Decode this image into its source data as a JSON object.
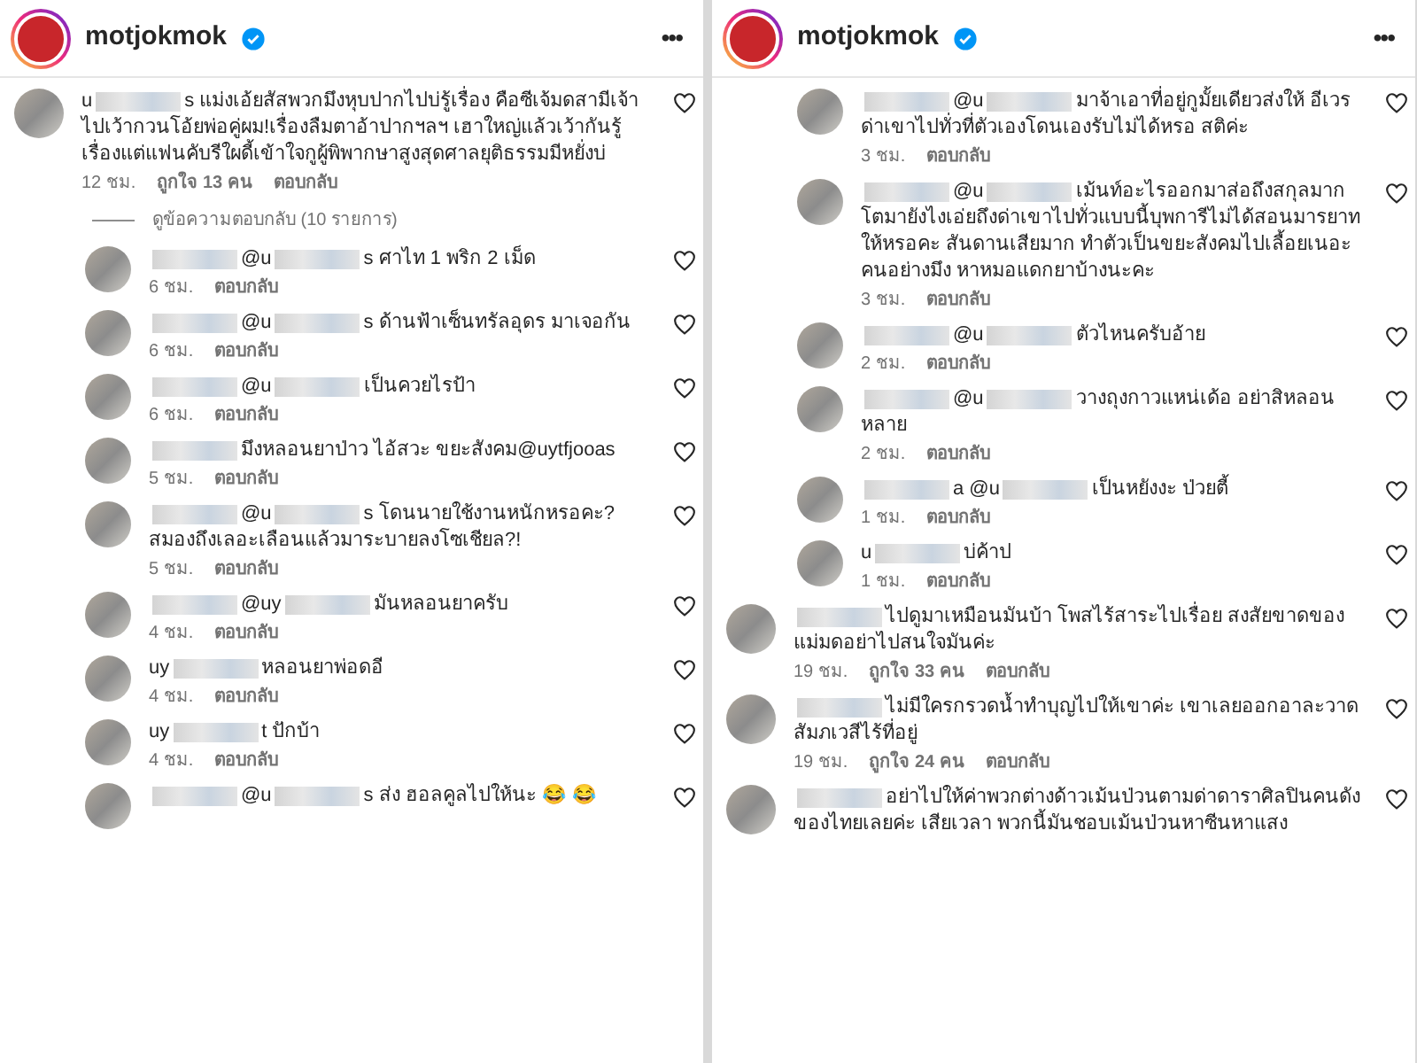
{
  "panels": [
    {
      "header": {
        "username": "motjokmok",
        "verified": true,
        "more": "•••"
      },
      "items": [
        {
          "kind": "comment",
          "segments": [
            {
              "kind": "text",
              "text": "u"
            },
            {
              "kind": "blur"
            },
            {
              "kind": "text",
              "text": "s แม่งเอ้ยสัสพวกมึงหุบปากไปบ่รู้เรื่อง คือซีเจ้มดสามีเจ้าไปเว้ากวนโอ้ยพ่อคู่ผม!เรื่องลืมตาอ้าปากฯลฯ เฮาใหญ่แล้วเว้ากันรู้เรื่องแต่แฟนคับรีใผดี้เข้าใจกูผู้พิพากษาสูงสุดศาลยุติธรรมมีหยั่งบ่"
            }
          ],
          "time": "12 ชม.",
          "likes": "ถูกใจ 13 คน",
          "reply": "ตอบกลับ"
        },
        {
          "kind": "view_replies",
          "text": "ดูข้อความตอบกลับ (10 รายการ)"
        },
        {
          "kind": "reply",
          "segments": [
            {
              "kind": "blur"
            },
            {
              "kind": "text",
              "text": "@u"
            },
            {
              "kind": "blur"
            },
            {
              "kind": "text",
              "text": "s ศาไท 1 พริก 2 เม็ด"
            }
          ],
          "time": "6 ชม.",
          "reply": "ตอบกลับ"
        },
        {
          "kind": "reply",
          "segments": [
            {
              "kind": "blur"
            },
            {
              "kind": "text",
              "text": "@u"
            },
            {
              "kind": "blur"
            },
            {
              "kind": "text",
              "text": "s ด้านฟ้าเซ็นทรัลอุดร มาเจอกัน"
            }
          ],
          "time": "6 ชม.",
          "reply": "ตอบกลับ"
        },
        {
          "kind": "reply",
          "segments": [
            {
              "kind": "blur"
            },
            {
              "kind": "text",
              "text": "@u"
            },
            {
              "kind": "blur"
            },
            {
              "kind": "text",
              "text": "เป็นควยไรป้า"
            }
          ],
          "time": "6 ชม.",
          "reply": "ตอบกลับ"
        },
        {
          "kind": "reply",
          "segments": [
            {
              "kind": "blur"
            },
            {
              "kind": "text",
              "text": "มึงหลอนยาป่าว ไอ้สวะ ขยะสังคม@uytfjooas"
            }
          ],
          "time": "5 ชม.",
          "reply": "ตอบกลับ"
        },
        {
          "kind": "reply",
          "segments": [
            {
              "kind": "blur"
            },
            {
              "kind": "text",
              "text": "@u"
            },
            {
              "kind": "blur"
            },
            {
              "kind": "text",
              "text": "s โดนนายใช้งานหนักหรอคะ? สมองถึงเลอะเลือนแล้วมาระบายลงโซเชียล?!"
            }
          ],
          "time": "5 ชม.",
          "reply": "ตอบกลับ"
        },
        {
          "kind": "reply",
          "segments": [
            {
              "kind": "blur"
            },
            {
              "kind": "text",
              "text": "@uy"
            },
            {
              "kind": "blur"
            },
            {
              "kind": "text",
              "text": "มันหลอนยาครับ"
            }
          ],
          "time": "4 ชม.",
          "reply": "ตอบกลับ"
        },
        {
          "kind": "reply",
          "segments": [
            {
              "kind": "text",
              "text": "uy"
            },
            {
              "kind": "blur"
            },
            {
              "kind": "text",
              "text": "หลอนยาพ่อดอี"
            }
          ],
          "time": "4 ชม.",
          "reply": "ตอบกลับ"
        },
        {
          "kind": "reply",
          "segments": [
            {
              "kind": "text",
              "text": "uy"
            },
            {
              "kind": "blur"
            },
            {
              "kind": "text",
              "text": "t ปักบ้า"
            }
          ],
          "time": "4 ชม.",
          "reply": "ตอบกลับ"
        },
        {
          "kind": "reply",
          "segments": [
            {
              "kind": "blur"
            },
            {
              "kind": "text",
              "text": "@u"
            },
            {
              "kind": "blur"
            },
            {
              "kind": "text",
              "text": "s ส่ง ฮอลคูลไปให้นะ 😂 😂"
            }
          ]
        }
      ]
    },
    {
      "header": {
        "username": "motjokmok",
        "verified": true,
        "more": "•••"
      },
      "items": [
        {
          "kind": "reply",
          "segments": [
            {
              "kind": "blur"
            },
            {
              "kind": "text",
              "text": "@u"
            },
            {
              "kind": "blur"
            },
            {
              "kind": "text",
              "text": "มาจ้าเอาที่อยู่กูมั้ยเดียวส่งให้ อีเวรด่าเขาไปทั่วที่ตัวเองโดนเองรับไม่ได้หรอ สติค่ะ"
            }
          ],
          "time": "3 ชม.",
          "reply": "ตอบกลับ"
        },
        {
          "kind": "reply",
          "segments": [
            {
              "kind": "blur"
            },
            {
              "kind": "text",
              "text": "@u"
            },
            {
              "kind": "blur"
            },
            {
              "kind": "text",
              "text": "เม้นท์อะไรออกมาส่อถึงสกุลมาก โตมายังไงเอ่ยถึงด่าเขาไปทั่วแบบนี้บุพการีไม่ได้สอนมารยาทให้หรอคะ สันดานเสียมาก ทำตัวเป็นขยะสังคมไปเลื้อยเนอะคนอย่างมึง หาหมอแดกยาบ้างนะคะ"
            }
          ],
          "time": "3 ชม.",
          "reply": "ตอบกลับ"
        },
        {
          "kind": "reply",
          "segments": [
            {
              "kind": "blur"
            },
            {
              "kind": "text",
              "text": "@u"
            },
            {
              "kind": "blur"
            },
            {
              "kind": "text",
              "text": "ตัวไหนครับอ้าย"
            }
          ],
          "time": "2 ชม.",
          "reply": "ตอบกลับ"
        },
        {
          "kind": "reply",
          "segments": [
            {
              "kind": "blur"
            },
            {
              "kind": "text",
              "text": "@u"
            },
            {
              "kind": "blur"
            },
            {
              "kind": "text",
              "text": "วางถุงกาวแหน่เด้อ อย่าสิหลอนหลาย"
            }
          ],
          "time": "2 ชม.",
          "reply": "ตอบกลับ"
        },
        {
          "kind": "reply",
          "segments": [
            {
              "kind": "blur"
            },
            {
              "kind": "text",
              "text": "a @u"
            },
            {
              "kind": "blur"
            },
            {
              "kind": "text",
              "text": "เป็นหยังงะ ป่วยตี้"
            }
          ],
          "time": "1 ชม.",
          "reply": "ตอบกลับ"
        },
        {
          "kind": "reply",
          "segments": [
            {
              "kind": "text",
              "text": "u"
            },
            {
              "kind": "blur"
            },
            {
              "kind": "text",
              "text": "บ่ค้าป"
            }
          ],
          "time": "1 ชม.",
          "reply": "ตอบกลับ"
        },
        {
          "kind": "comment",
          "segments": [
            {
              "kind": "blur"
            },
            {
              "kind": "text",
              "text": "ไปดูมาเหมือนมันบ้า โพสไร้สาระไปเรื่อย สงสัยขาดของ แม่มดอย่าไปสนใจมันค่ะ"
            }
          ],
          "time": "19 ชม.",
          "likes": "ถูกใจ 33 คน",
          "reply": "ตอบกลับ"
        },
        {
          "kind": "comment",
          "segments": [
            {
              "kind": "blur"
            },
            {
              "kind": "text",
              "text": "ไม่มีใครกรวดน้ำทำบุญไปให้เขาค่ะ เขาเลยออกอาละวาดสัมภเวสีไร้ที่อยู่"
            }
          ],
          "time": "19 ชม.",
          "likes": "ถูกใจ 24 คน",
          "reply": "ตอบกลับ"
        },
        {
          "kind": "comment",
          "segments": [
            {
              "kind": "blur"
            },
            {
              "kind": "text",
              "text": "อย่าไปให้ค่าพวกต่างด้าวเม้นป่วนตามด่าดาราศิลปินคนดังของไทยเลยค่ะ เสียเวลา พวกนี้มันชอบเม้นป่วนหาซีนหาแสง"
            }
          ]
        }
      ]
    }
  ]
}
